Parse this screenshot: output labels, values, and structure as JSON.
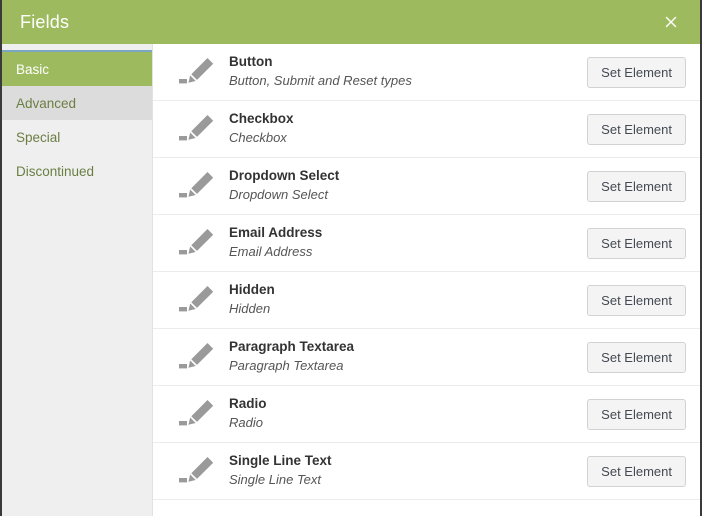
{
  "header": {
    "title": "Fields",
    "close_label": "×",
    "close_icon": "close-icon",
    "background_color": "#9dbb5e",
    "text_color": "#ffffff"
  },
  "sidebar": {
    "items": [
      {
        "label": "Basic",
        "state": "active"
      },
      {
        "label": "Advanced",
        "state": "hovered"
      },
      {
        "label": "Special",
        "state": "normal"
      },
      {
        "label": "Discontinued",
        "state": "normal"
      }
    ]
  },
  "content": {
    "action_label": "Set Element",
    "row_icon": "pencil-icon",
    "rows": [
      {
        "title": "Button",
        "subtitle": "Button, Submit and Reset types"
      },
      {
        "title": "Checkbox",
        "subtitle": "Checkbox"
      },
      {
        "title": "Dropdown Select",
        "subtitle": "Dropdown Select"
      },
      {
        "title": "Email Address",
        "subtitle": "Email Address"
      },
      {
        "title": "Hidden",
        "subtitle": "Hidden"
      },
      {
        "title": "Paragraph Textarea",
        "subtitle": "Paragraph Textarea"
      },
      {
        "title": "Radio",
        "subtitle": "Radio"
      },
      {
        "title": "Single Line Text",
        "subtitle": "Single Line Text"
      }
    ]
  },
  "colors": {
    "accent_green": "#9dbb5e",
    "sidebar_bg": "#efefef",
    "sidebar_hover": "#dcdcdc",
    "rule_blue": "#7ba7c4",
    "icon_gray": "#9a9a9a",
    "border_dark": "#3a3a3a"
  }
}
